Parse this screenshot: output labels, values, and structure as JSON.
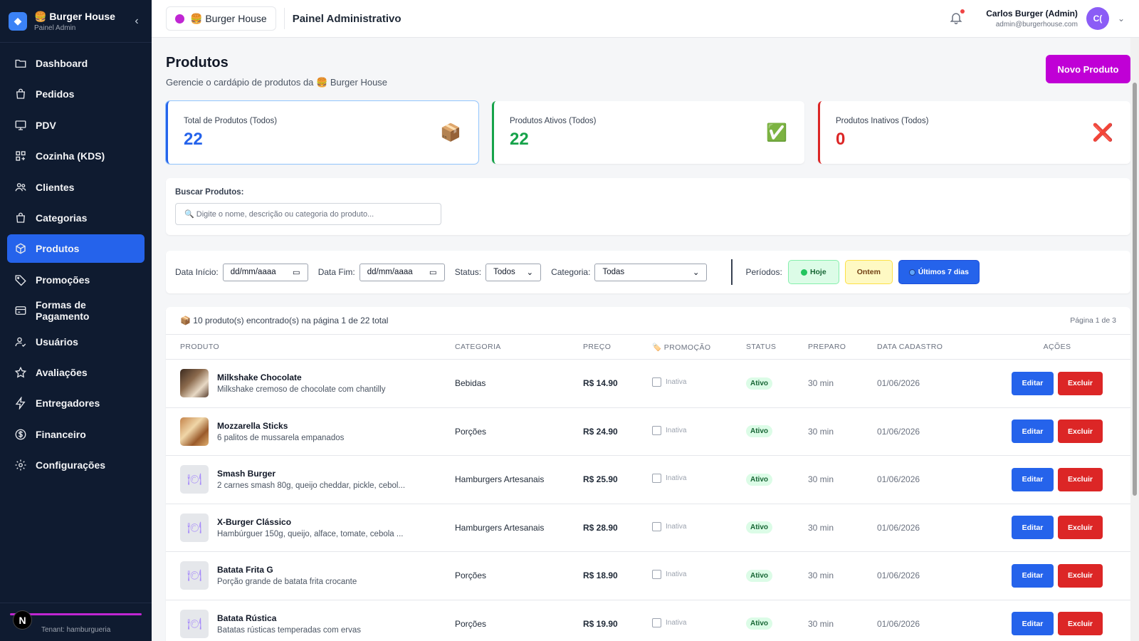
{
  "sidebar": {
    "brand_title": "🍔 Burger House",
    "brand_sub": "Painel Admin",
    "items": [
      {
        "label": "Dashboard",
        "icon": "folder-icon"
      },
      {
        "label": "Pedidos",
        "icon": "bag-icon"
      },
      {
        "label": "PDV",
        "icon": "monitor-icon"
      },
      {
        "label": "Cozinha (KDS)",
        "icon": "grid-icon"
      },
      {
        "label": "Clientes",
        "icon": "users-icon"
      },
      {
        "label": "Categorias",
        "icon": "bag-icon"
      },
      {
        "label": "Produtos",
        "icon": "cube-icon",
        "active": true
      },
      {
        "label": "Promoções",
        "icon": "tag-icon"
      },
      {
        "label": "Formas de Pagamento",
        "icon": "card-icon"
      },
      {
        "label": "Usuários",
        "icon": "user-check-icon"
      },
      {
        "label": "Avaliações",
        "icon": "star-icon"
      },
      {
        "label": "Entregadores",
        "icon": "bolt-icon"
      },
      {
        "label": "Financeiro",
        "icon": "dollar-icon"
      },
      {
        "label": "Configurações",
        "icon": "gear-icon"
      }
    ],
    "footer_avatar": "N",
    "footer_tenant": "Tenant: hamburgueria"
  },
  "topbar": {
    "store": "🍔 Burger House",
    "panel_title": "Painel Administrativo",
    "user_name": "Carlos Burger (Admin)",
    "user_email": "admin@burgerhouse.com",
    "avatar": "C("
  },
  "page": {
    "title": "Produtos",
    "subtitle": "Gerencie o cardápio de produtos da 🍔 Burger House",
    "new_button": "Novo Produto"
  },
  "cards": [
    {
      "label": "Total de Produtos (Todos)",
      "value": "22",
      "icon": "📦"
    },
    {
      "label": "Produtos Ativos (Todos)",
      "value": "22",
      "icon": "✅"
    },
    {
      "label": "Produtos Inativos (Todos)",
      "value": "0",
      "icon": "❌"
    }
  ],
  "search": {
    "label": "Buscar Produtos:",
    "placeholder": "🔍 Digite o nome, descrição ou categoria do produto..."
  },
  "filters": {
    "start_label": "Data Início:",
    "start_value": "dd/mm/aaaa",
    "end_label": "Data Fim:",
    "end_value": "dd/mm/aaaa",
    "status_label": "Status:",
    "status_value": "Todos",
    "category_label": "Categoria:",
    "category_value": "Todas",
    "periods_label": "Períodos:",
    "today": "Hoje",
    "yesterday": "Ontem",
    "last7": "Últimos 7 dias"
  },
  "table": {
    "info": "📦 10 produto(s) encontrado(s) na página 1 de 22 total",
    "page_info": "Página 1 de 3",
    "headers": [
      "PRODUTO",
      "CATEGORIA",
      "PREÇO",
      "🏷️ PROMOÇÃO",
      "STATUS",
      "PREPARO",
      "DATA CADASTRO",
      "AÇÕES"
    ],
    "promo_label": "Inativa",
    "edit_label": "Editar",
    "delete_label": "Excluir",
    "rows": [
      {
        "name": "Milkshake Chocolate",
        "desc": "Milkshake cremoso de chocolate com chantilly",
        "category": "Bebidas",
        "price": "R$ 14.90",
        "status": "Ativo",
        "prep": "30 min",
        "date": "01/06/2026",
        "thumb": "photo1"
      },
      {
        "name": "Mozzarella Sticks",
        "desc": "6 palitos de mussarela empanados",
        "category": "Porções",
        "price": "R$ 24.90",
        "status": "Ativo",
        "prep": "30 min",
        "date": "01/06/2026",
        "thumb": "photo2"
      },
      {
        "name": "Smash Burger",
        "desc": "2 carnes smash 80g, queijo cheddar, pickle, cebol...",
        "category": "Hamburgers Artesanais",
        "price": "R$ 25.90",
        "status": "Ativo",
        "prep": "30 min",
        "date": "01/06/2026",
        "thumb": "placeholder"
      },
      {
        "name": "X-Burger Clássico",
        "desc": "Hambúrguer 150g, queijo, alface, tomate, cebola ...",
        "category": "Hamburgers Artesanais",
        "price": "R$ 28.90",
        "status": "Ativo",
        "prep": "30 min",
        "date": "01/06/2026",
        "thumb": "placeholder"
      },
      {
        "name": "Batata Frita G",
        "desc": "Porção grande de batata frita crocante",
        "category": "Porções",
        "price": "R$ 18.90",
        "status": "Ativo",
        "prep": "30 min",
        "date": "01/06/2026",
        "thumb": "placeholder"
      },
      {
        "name": "Batata Rústica",
        "desc": "Batatas rústicas temperadas com ervas",
        "category": "Porções",
        "price": "R$ 19.90",
        "status": "Ativo",
        "prep": "30 min",
        "date": "01/06/2026",
        "thumb": "placeholder"
      }
    ]
  }
}
